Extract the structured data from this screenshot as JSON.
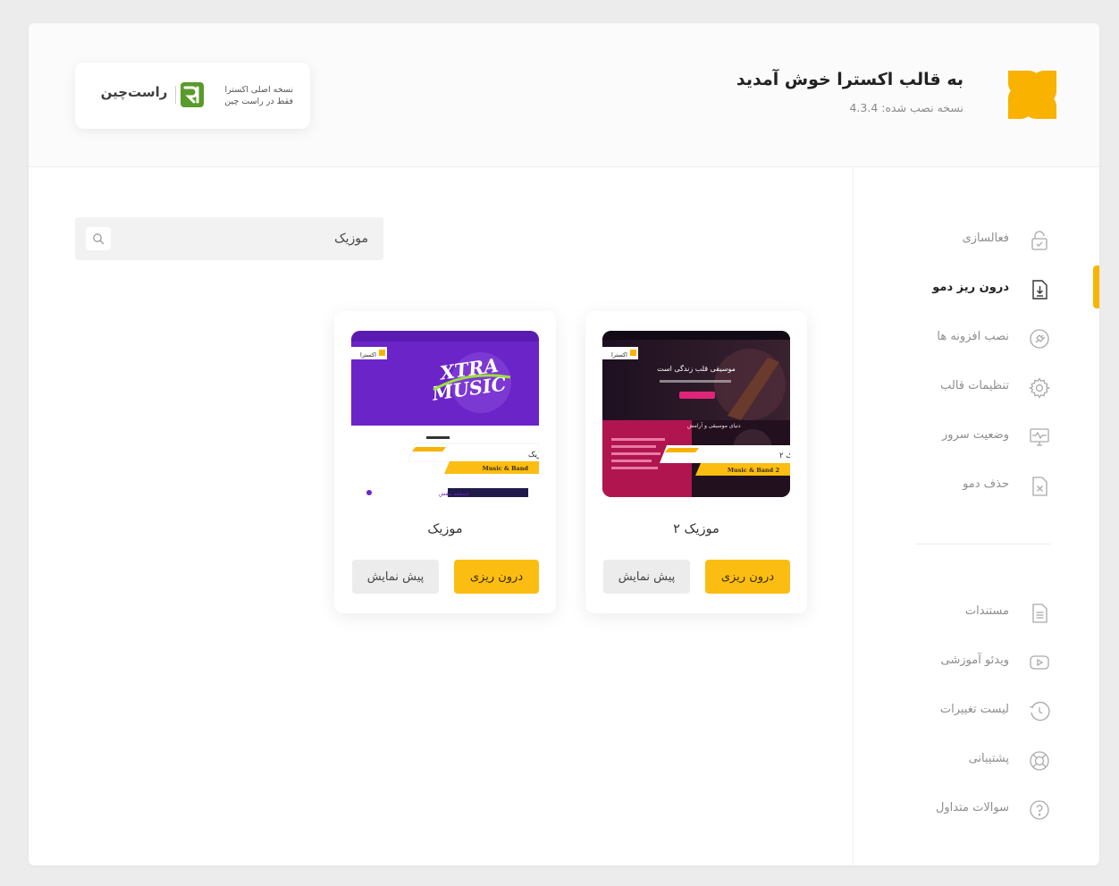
{
  "header": {
    "title": "به قالب اکسترا خوش آمدید",
    "version_label": "نسخه نصب شده: 4.3.4",
    "badge": {
      "line1": "نسخه اصلی اکسترا",
      "line2": "فقط در راست چین",
      "brand": "راست‌چین"
    }
  },
  "sidebar": {
    "items": [
      {
        "label": "فعالسازی",
        "icon": "lock-check-icon"
      },
      {
        "label": "درون ریز دمو",
        "icon": "file-download-icon",
        "active": true
      },
      {
        "label": "نصب افزونه ها",
        "icon": "plugin-icon"
      },
      {
        "label": "تنظیمات قالب",
        "icon": "gear-icon"
      },
      {
        "label": "وضعیت سرور",
        "icon": "monitor-pulse-icon"
      },
      {
        "label": "حذف دمو",
        "icon": "file-remove-icon"
      }
    ],
    "secondary": [
      {
        "label": "مستندات",
        "icon": "document-icon"
      },
      {
        "label": "ویدئو آموزشی",
        "icon": "video-icon"
      },
      {
        "label": "لیست تغییرات",
        "icon": "history-icon"
      },
      {
        "label": "پشتیبانی",
        "icon": "lifebuoy-icon"
      },
      {
        "label": "سوالات متداول",
        "icon": "question-icon"
      }
    ]
  },
  "search": {
    "value": "موزیک",
    "icon": "search-icon"
  },
  "demos": [
    {
      "title": "موزیک ۲",
      "import_label": "درون ریزی",
      "preview_label": "پیش نمایش",
      "thumb": {
        "site_name": "اکسترا",
        "hero_text": "موسیقی قلب زندگی است",
        "section_text": "دنیای موسیقی و آرامش",
        "label_fa": "موزیک ۲",
        "label_en": "Music & Band 2"
      }
    },
    {
      "title": "موزیک",
      "import_label": "درون ریزی",
      "preview_label": "پیش نمایش",
      "thumb": {
        "site_name": "اکسترا",
        "hero_text_1": "XTRA",
        "hero_text_2": "MUSIC",
        "label_fa": "موزیک",
        "label_en": "Music & Band",
        "footer_text": "جمجمه بنفش"
      }
    }
  ],
  "colors": {
    "accent": "#fbbd12",
    "accent_bar": "#f7b500",
    "text": "#333333",
    "muted": "#8e8e8e"
  }
}
